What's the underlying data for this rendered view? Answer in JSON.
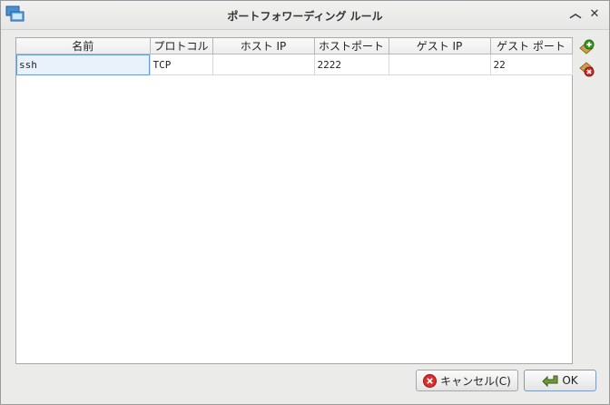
{
  "window": {
    "title": "ポートフォワーディング ルール"
  },
  "titlebar_icons": {
    "app": "virtualbox-icon",
    "minimize": "chevron-up-icon",
    "close": "close-icon"
  },
  "table": {
    "columns": [
      "名前",
      "プロトコル",
      "ホスト IP",
      "ホストポート",
      "ゲスト IP",
      "ゲスト ポート"
    ],
    "rows": [
      {
        "name": "ssh",
        "protocol": "TCP",
        "host_ip": "",
        "host_port": "2222",
        "guest_ip": "",
        "guest_port": "22"
      }
    ]
  },
  "side_buttons": {
    "add": "add-rule-icon",
    "remove": "remove-rule-icon"
  },
  "buttons": {
    "cancel": "キャンセル(C)",
    "ok": "OK"
  },
  "colors": {
    "selection": "#e9f1fa",
    "add": "#3a9a28",
    "remove": "#d02a2a"
  }
}
